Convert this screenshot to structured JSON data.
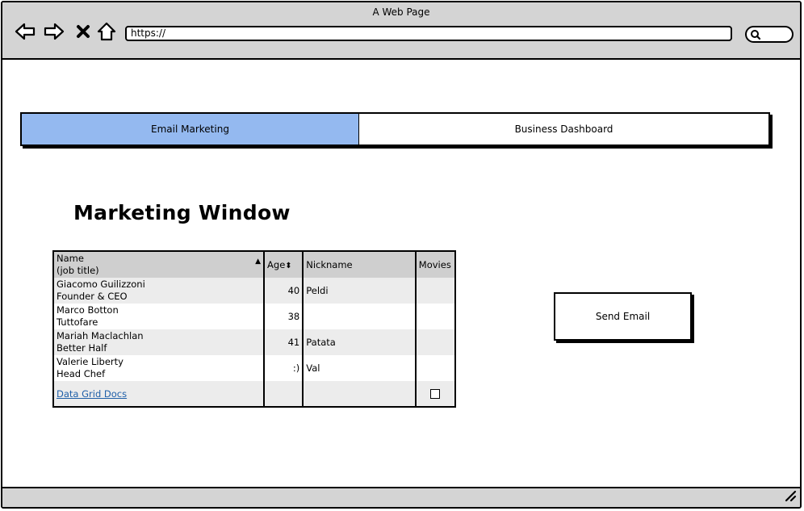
{
  "window": {
    "title": "A Web Page"
  },
  "browser": {
    "url": "https://",
    "icons": [
      "back-icon",
      "forward-icon",
      "close-icon",
      "home-icon",
      "search-icon"
    ]
  },
  "tabs": [
    {
      "label": "Email Marketing",
      "active": true
    },
    {
      "label": "Business Dashboard",
      "active": false
    }
  ],
  "page": {
    "heading": "Marketing Window"
  },
  "grid": {
    "columns": {
      "name_line1": "Name",
      "name_line2": "(job title)",
      "age": "Age",
      "nickname": "Nickname",
      "movies": "Movies"
    },
    "rows": [
      {
        "name": "Giacomo Guilizzoni",
        "title": "Founder & CEO",
        "age": "40",
        "nickname": "Peldi"
      },
      {
        "name": "Marco Botton",
        "title": "Tuttofare",
        "age": "38",
        "nickname": ""
      },
      {
        "name": "Mariah Maclachlan",
        "title": "Better Half",
        "age": "41",
        "nickname": "Patata"
      },
      {
        "name": "Valerie Liberty",
        "title": "Head Chef",
        "age": ":)",
        "nickname": "Val"
      }
    ],
    "footer_link": "Data Grid Docs"
  },
  "actions": {
    "send_email": "Send Email"
  },
  "colors": {
    "active_tab": "#94b9f0",
    "chrome": "#d4d4d4",
    "row_shade": "#ececec",
    "link": "#1f5fa8"
  }
}
